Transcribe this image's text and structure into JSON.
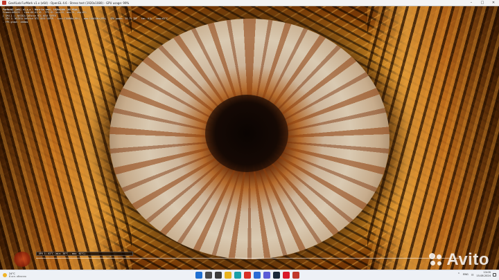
{
  "window": {
    "title": "GeeXLab FurMark v1.x (x64) - OpenGL 4.6 - Stress test (1920x1080) - GPU usage: 99%"
  },
  "osd": {
    "lines": [
      "FurMark2 (x64) v2.x.x - Burn-in test, 1920x1080 (0X MSAA)",
      "Frames:005435 - time:00:01:05 - FPS:83 (min:52, max:91, avg:83)",
      "[ GPU-1 ]: NVIDIA GeForce RTX 4070 SUPER",
      "- GPU 1: NVIDIA GeForce RTX 4070 SUPER - core:2760MHz(99%) - mem:10501MHz(99%) - GPU power: 95.7% TDP - fan: 61% - temp:62°C",
      "- FPS graph: 1000ms"
    ]
  },
  "progress": {
    "label": "GPU 1: 62°C (min: 36°C - max: 62°C)"
  },
  "watermark": {
    "text": "Avito"
  },
  "taskbar": {
    "weather_temp": "24°C",
    "weather_cond": "В осн. облачно",
    "lang": "ENG",
    "time": "13:05",
    "date": "15.08.2024",
    "apps": [
      {
        "name": "start",
        "color": "#1f6fd1"
      },
      {
        "name": "search",
        "color": "#4a4a4a"
      },
      {
        "name": "task-view",
        "color": "#3b3b3b"
      },
      {
        "name": "file-explorer",
        "color": "#e8b21c"
      },
      {
        "name": "edge",
        "color": "#1aa0a8"
      },
      {
        "name": "chrome",
        "color": "#d93025"
      },
      {
        "name": "mail",
        "color": "#2b6cd4"
      },
      {
        "name": "store",
        "color": "#5b5bd6"
      },
      {
        "name": "steam",
        "color": "#1b2838"
      },
      {
        "name": "opera",
        "color": "#d91a2a"
      },
      {
        "name": "furmark",
        "color": "#c0392b"
      }
    ]
  }
}
